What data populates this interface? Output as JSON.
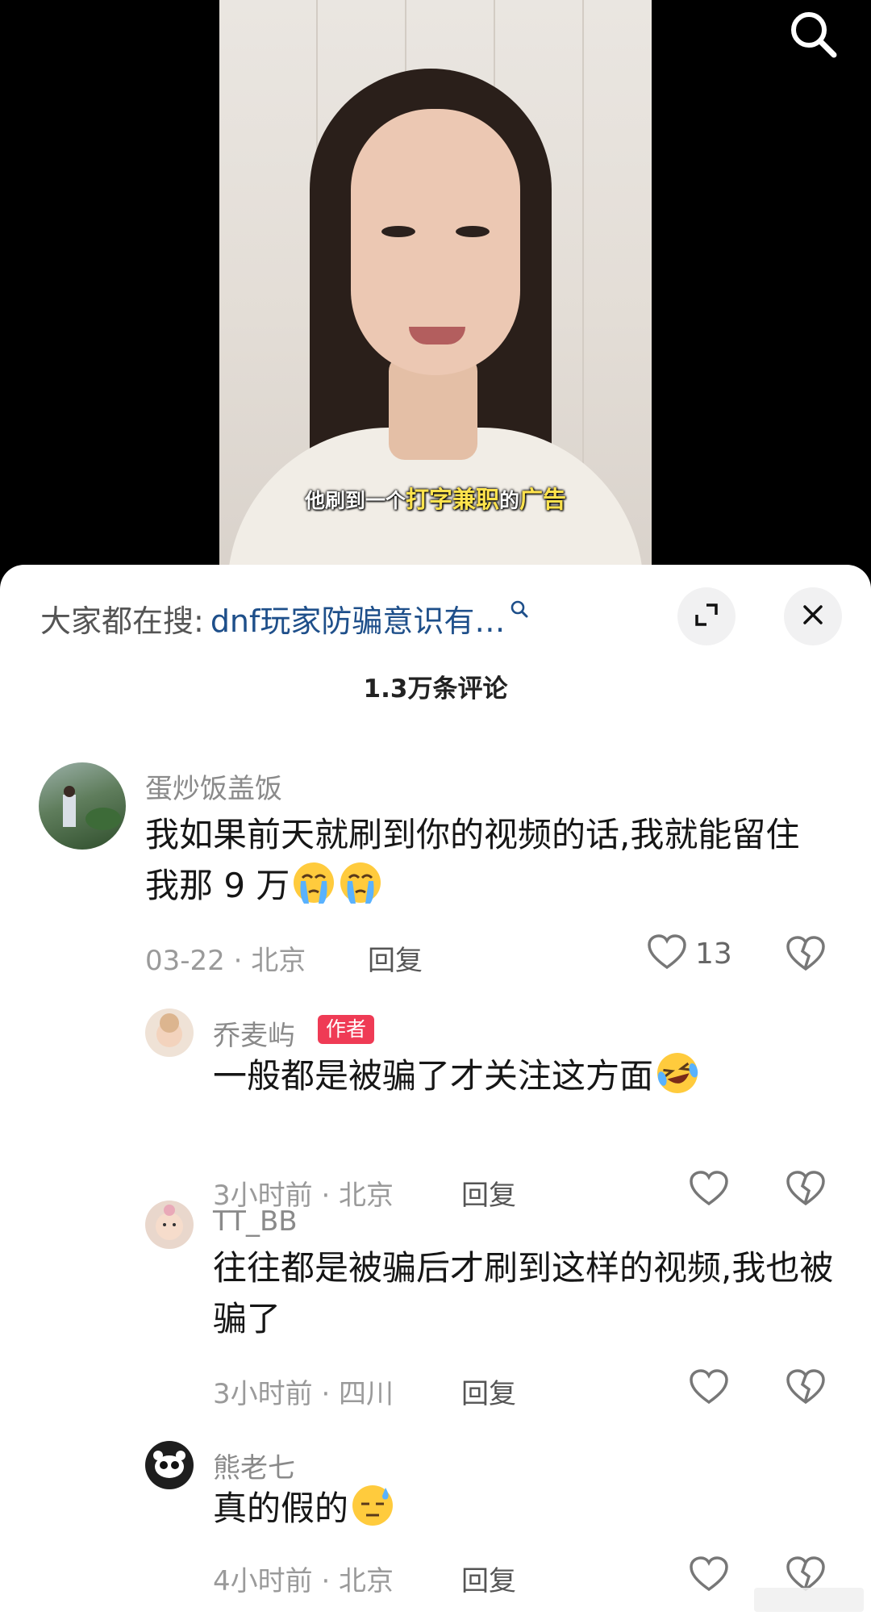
{
  "video": {
    "subtitle_pre": "他刷到一个",
    "subtitle_hl": "打字兼职",
    "subtitle_mid": "的",
    "subtitle_end": "广告"
  },
  "top_icons": {
    "search": "search-icon"
  },
  "panel": {
    "search_prefix": "大家都在搜:",
    "search_term": "dnf玩家防骗意识有…",
    "comment_count": "1.3万条评论",
    "icons": {
      "expand": "expand-icon",
      "close": "close-icon",
      "search_mini": "search-icon"
    }
  },
  "comments": [
    {
      "username": "蛋炒饭盖饭",
      "text": "我如果前天就刷到你的视频的话,我就能留住我那 9 万",
      "emoji": "crying-face-emoji x2",
      "date": "03-22 · 北京",
      "reply": "回复",
      "likes": "13"
    },
    {
      "username": "乔麦屿",
      "badge": "作者",
      "text": "一般都是被骗了才关注这方面",
      "emoji": "laughing-tears-emoji",
      "date": "3小时前 · 北京",
      "reply": "回复"
    },
    {
      "username": "TT_BB",
      "text": "往往都是被骗后才刷到这样的视频,我也被骗了",
      "date": "3小时前 · 四川",
      "reply": "回复"
    },
    {
      "username": "熊老七",
      "text": "真的假的",
      "emoji": "sweat-face-emoji",
      "date": "4小时前 · 北京",
      "reply": "回复"
    }
  ],
  "colors": {
    "link": "#1e4f8a",
    "badge": "#ef3b55",
    "meta": "#9a9a9a"
  }
}
